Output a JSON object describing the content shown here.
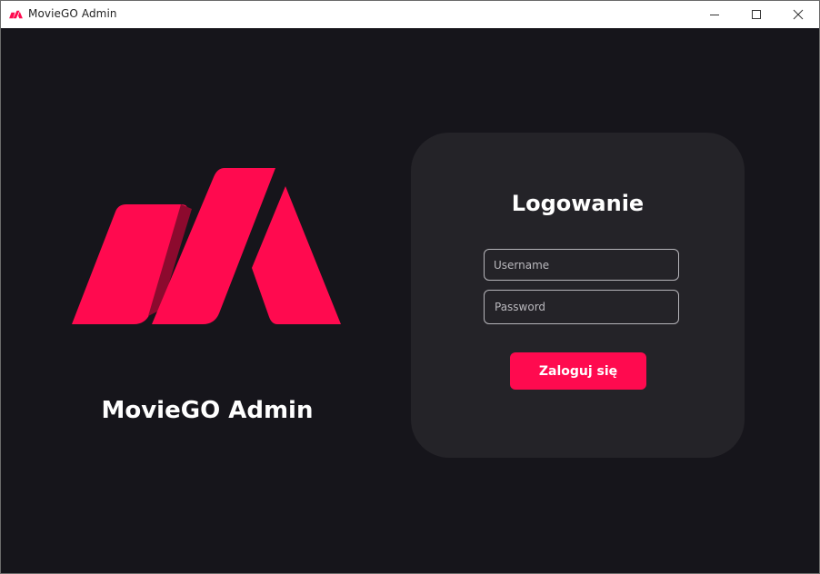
{
  "window": {
    "title": "MovieGO Admin",
    "icon": "moviego-logo-icon",
    "controls": {
      "minimize": "minimize-icon",
      "maximize": "maximize-icon",
      "close": "close-icon"
    }
  },
  "brand": {
    "name": "MovieGO Admin",
    "logo": "moviego-logo",
    "color": "#ff0a4f"
  },
  "login": {
    "title": "Logowanie",
    "username_placeholder": "Username",
    "username_value": "",
    "password_placeholder": "Password",
    "password_value": "",
    "submit_label": "Zaloguj się"
  },
  "colors": {
    "background": "#16151b",
    "card": "#242328",
    "accent": "#ff0a4f",
    "accent_dark": "#8c0a2e",
    "text": "#ffffff",
    "field_border": "#b6b5ba"
  }
}
